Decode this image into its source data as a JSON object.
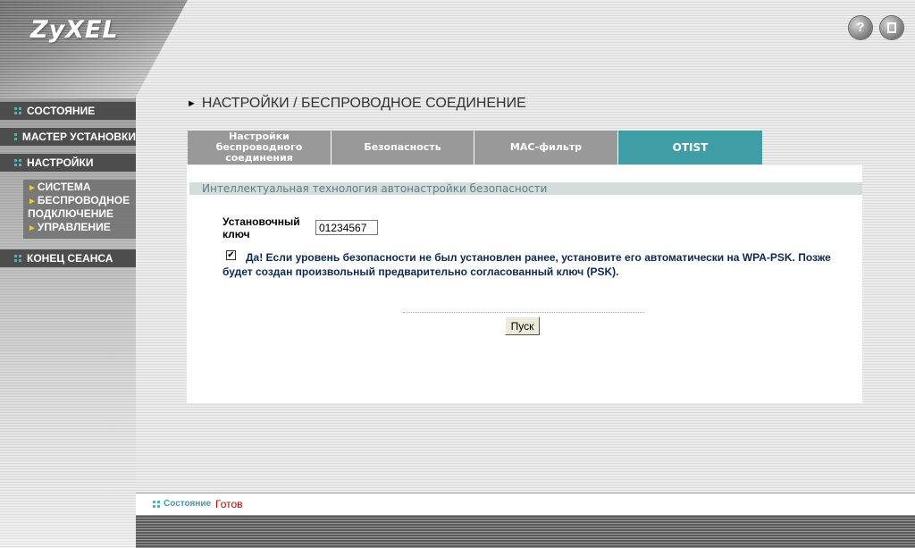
{
  "brand": {
    "logo": "ZyXEL"
  },
  "header": {
    "help_label": "?",
    "page_title": "НАСТРОЙКИ / БЕСПРОВОДНОЕ СОЕДИНЕНИЕ"
  },
  "sidebar": {
    "items": [
      {
        "label": "СОСТОЯНИЕ"
      },
      {
        "label": "МАСТЕР УСТАНОВКИ"
      },
      {
        "label": "НАСТРОЙКИ"
      },
      {
        "label": "КОНЕЦ СЕАНСА"
      }
    ],
    "subitems": [
      {
        "label": "СИСТЕМА"
      },
      {
        "label": "БЕСПРОВОДНОЕ"
      },
      {
        "label": "ПОДКЛЮЧЕНИЕ"
      },
      {
        "label": "УПРАВЛЕНИЕ"
      }
    ]
  },
  "tabs": [
    {
      "label": "Настройки беспроводного соединения",
      "active": false
    },
    {
      "label": "Безопасность",
      "active": false
    },
    {
      "label": "MAC-фильтр",
      "active": false
    },
    {
      "label": "OTIST",
      "active": true
    }
  ],
  "main": {
    "section_title": "Интеллектуальная технология автонастройки безопасности",
    "key_label": "Установочный ключ",
    "key_value": "01234567",
    "checkbox_checked": true,
    "checkbox_text": "Да! Если уровень безопасности не был установлен ранее, установите его автоматически на WPA-PSK. Позже будет создан произвольный предварительно согласованный ключ (PSK).",
    "go_button": "Пуск"
  },
  "status": {
    "label": "Состояние",
    "value": "Готов"
  },
  "colors": {
    "accent": "#3f9ea5",
    "nav_bg": "#4d4d4d",
    "tab_bg": "#999999",
    "status_value": "#c00000"
  }
}
